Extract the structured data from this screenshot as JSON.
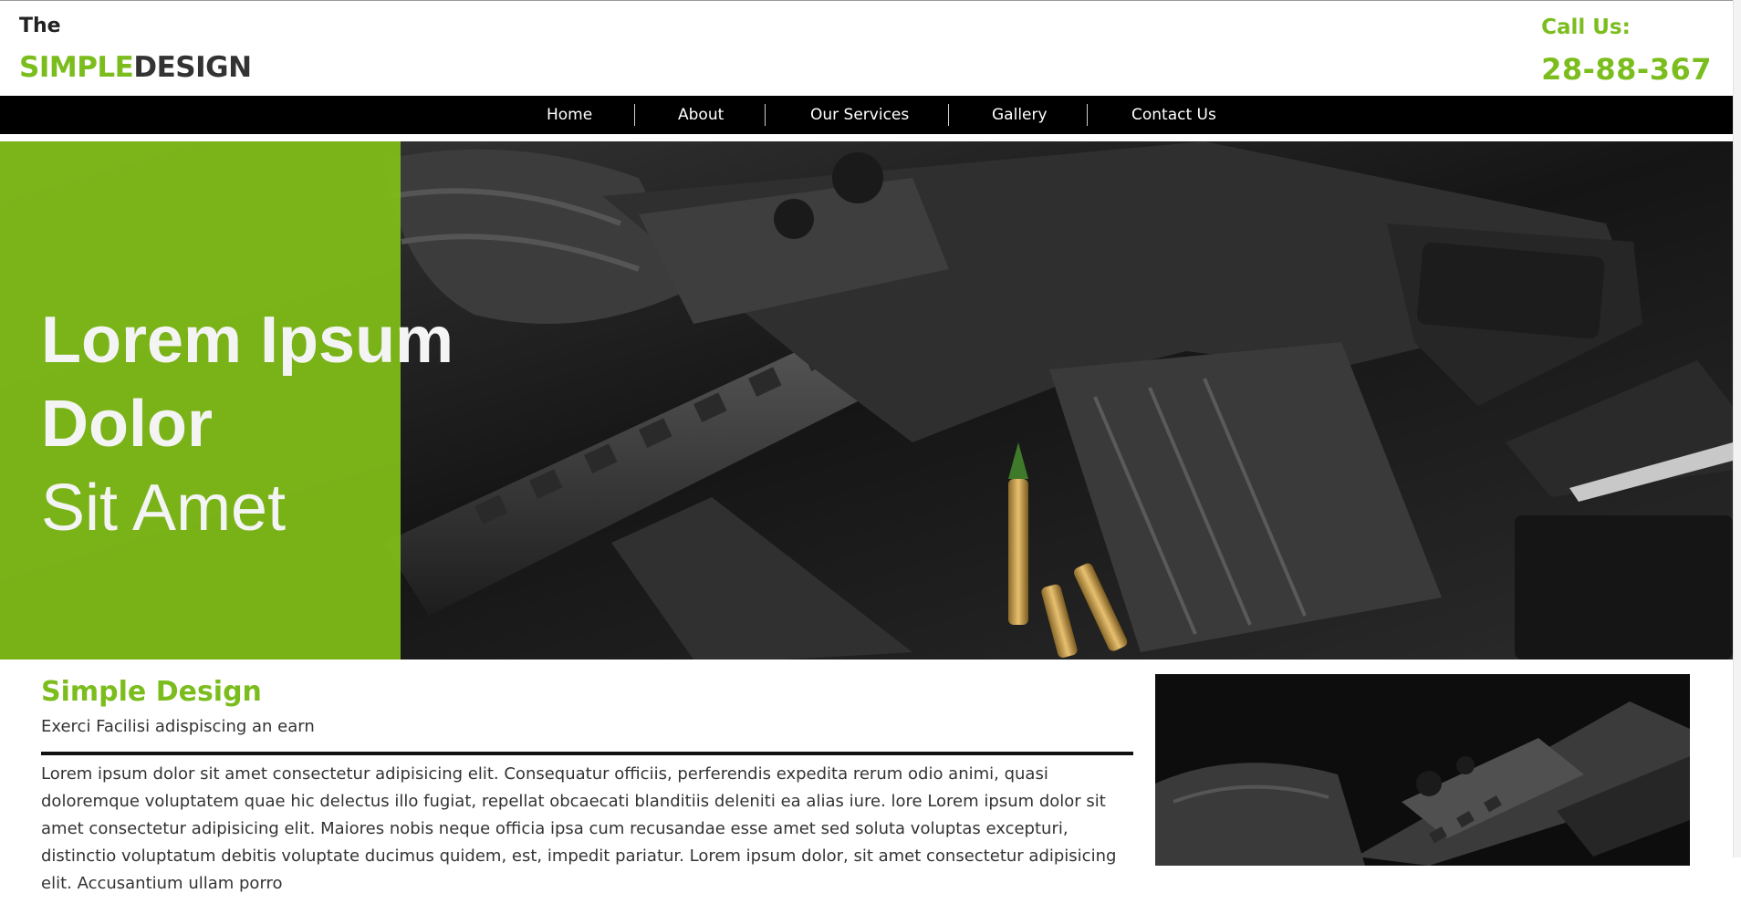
{
  "header": {
    "logo_the": "The",
    "logo_simple": "SIMPLE",
    "logo_design": "DESIGN",
    "call_label": "Call Us:",
    "phone": "28-88-367"
  },
  "nav": {
    "items": [
      {
        "label": "Home"
      },
      {
        "label": "About"
      },
      {
        "label": "Our Services"
      },
      {
        "label": "Gallery"
      },
      {
        "label": "Contact Us"
      }
    ]
  },
  "hero": {
    "line1": "Lorem Ipsum",
    "line2": "Dolor",
    "line3": "Sit Amet"
  },
  "section": {
    "title": "Simple Design",
    "subtitle": "Exerci Facilisi adispiscing an earn",
    "body": "Lorem ipsum dolor sit amet consectetur adipisicing elit. Consequatur officiis, perferendis expedita rerum odio animi, quasi doloremque voluptatem quae hic delectus illo fugiat, repellat obcaecati blanditiis deleniti ea alias iure. lore Lorem ipsum dolor sit amet consectetur adipisicing elit. Maiores nobis neque officia ipsa cum recusandae esse amet sed soluta voluptas excepturi, distinctio voluptatum debitis voluptate ducimus quidem, est, impedit pariatur. Lorem ipsum dolor, sit amet consectetur adipisicing elit. Accusantium ullam porro"
  },
  "colors": {
    "accent": "#7cbd1e",
    "nav_bg": "#000000",
    "text": "#333333"
  }
}
